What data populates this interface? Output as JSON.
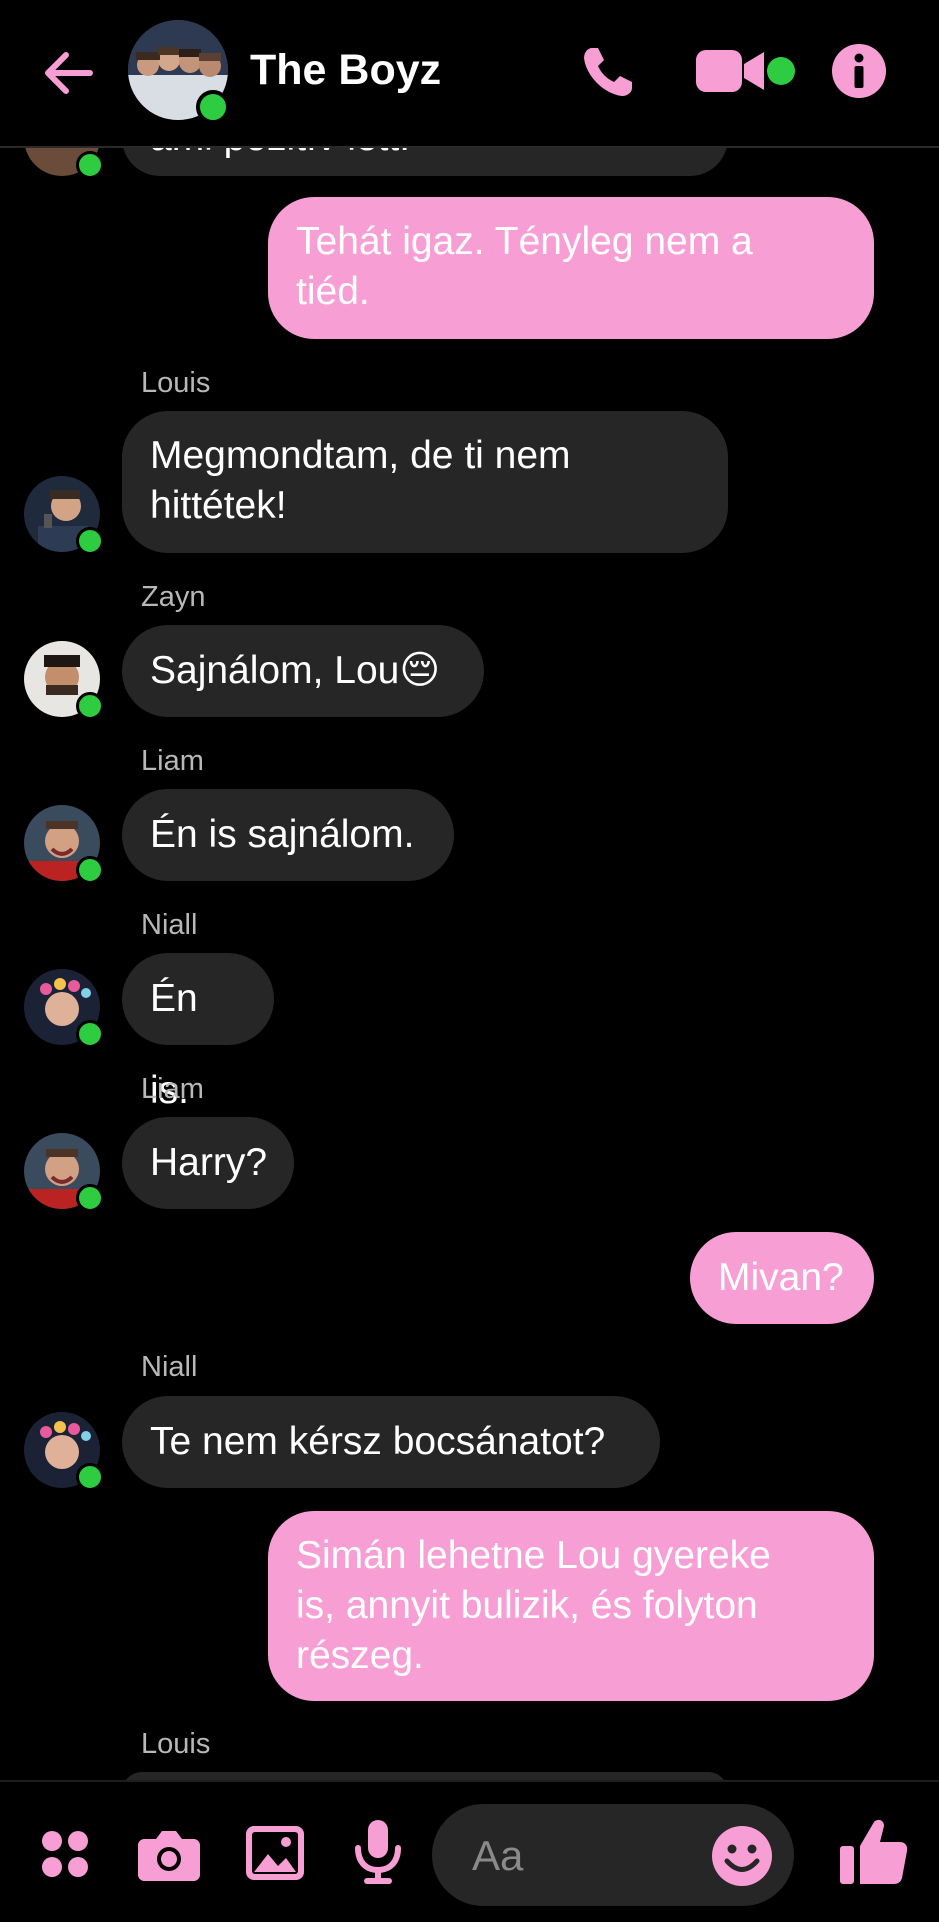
{
  "header": {
    "title": "The Boyz"
  },
  "colors": {
    "accent": "#f79fd4",
    "online": "#2ecc40",
    "incoming_bubble": "#262626",
    "background": "#000000"
  },
  "messages": {
    "m1": {
      "sender": "",
      "text": "ami pozitív lett."
    },
    "m2": {
      "sender": "",
      "line1": "Tehát igaz. Tényleg nem a",
      "line2": "tiéd."
    },
    "m3": {
      "sender": "Louis",
      "line1": "Megmondtam, de ti nem",
      "line2": "hittétek!"
    },
    "m4": {
      "sender": "Zayn",
      "text": "Sajnálom, Lou",
      "emoji": "😔"
    },
    "m5": {
      "sender": "Liam",
      "text": "Én is sajnálom."
    },
    "m6": {
      "sender": "Niall",
      "text": "Én is."
    },
    "m7": {
      "sender": "Liam",
      "text": "Harry?"
    },
    "m8": {
      "text": "Mivan?"
    },
    "m9": {
      "sender": "Niall",
      "text": "Te nem kérsz bocsánatot?"
    },
    "m10": {
      "line1": "Simán lehetne Lou gyereke",
      "line2": "is, annyit bulizik, és folyton",
      "line3": "részeg."
    },
    "m11": {
      "sender": "Louis"
    }
  },
  "composer": {
    "placeholder": "Aa"
  },
  "icons": {
    "back": "arrow-left-icon",
    "call": "phone-icon",
    "video": "video-camera-icon",
    "info": "info-icon",
    "more": "four-dots-icon",
    "camera": "camera-icon",
    "gallery": "image-icon",
    "voice": "microphone-icon",
    "emoji": "smiley-icon",
    "like": "thumbs-up-icon"
  }
}
